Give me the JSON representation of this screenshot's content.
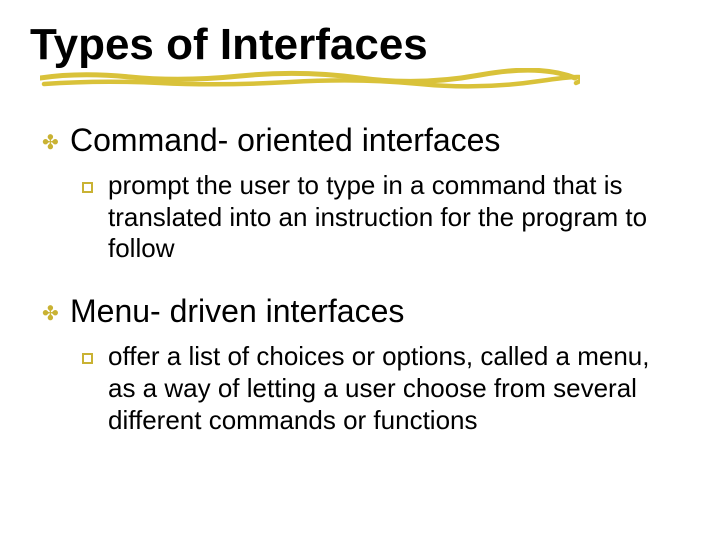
{
  "title": "Types of Interfaces",
  "sections": [
    {
      "heading": "Command- oriented interfaces",
      "body": "prompt the user to type in a command that is translated into an instruction for the program to follow"
    },
    {
      "heading": "Menu- driven interfaces",
      "body": "offer a list of choices or options, called a menu, as a way of letting a user choose from several different commands or functions"
    }
  ]
}
